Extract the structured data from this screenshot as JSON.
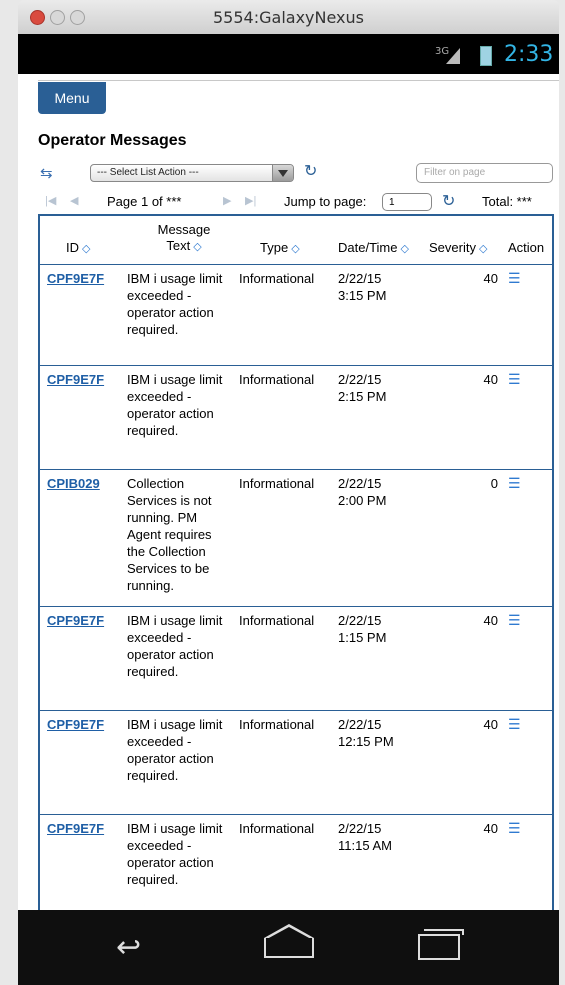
{
  "window": {
    "title": "5554:GalaxyNexus"
  },
  "status_bar": {
    "network": "3G",
    "time": "2:33"
  },
  "header": {
    "menu_label": "Menu",
    "page_title": "Operator Messages"
  },
  "toolbar": {
    "select_value": "--- Select List Action ---",
    "filter_placeholder": "Filter on page"
  },
  "pager": {
    "page_label": "Page 1 of ***",
    "jump_label": "Jump to page:",
    "jump_value": "1",
    "total_label": "Total: ***"
  },
  "table": {
    "columns": [
      "ID",
      "Message Text",
      "Type",
      "Date/Time",
      "Severity",
      "Action"
    ],
    "rows": [
      {
        "id": "CPF9E7F",
        "text": "IBM i usage limit exceeded - operator action required.",
        "type": "Informational",
        "date": "2/22/15",
        "time": "3:15 PM",
        "severity": "40"
      },
      {
        "id": "CPF9E7F",
        "text": "IBM i usage limit exceeded - operator action required.",
        "type": "Informational",
        "date": "2/22/15",
        "time": "2:15 PM",
        "severity": "40"
      },
      {
        "id": "CPIB029",
        "text": "Collection Services is not running. PM Agent requires the Collection Services to be running.",
        "type": "Informational",
        "date": "2/22/15",
        "time": "2:00 PM",
        "severity": "0"
      },
      {
        "id": "CPF9E7F",
        "text": "IBM i usage limit exceeded - operator action required.",
        "type": "Informational",
        "date": "2/22/15",
        "time": "1:15 PM",
        "severity": "40"
      },
      {
        "id": "CPF9E7F",
        "text": "IBM i usage limit exceeded - operator action required.",
        "type": "Informational",
        "date": "2/22/15",
        "time": "12:15 PM",
        "severity": "40"
      },
      {
        "id": "CPF9E7F",
        "text": "IBM i usage limit exceeded - operator action required.",
        "type": "Informational",
        "date": "2/22/15",
        "time": "11:15 AM",
        "severity": "40"
      }
    ]
  },
  "icons": {
    "list_action": "arrows-icon",
    "refresh": "refresh-icon",
    "row_action": "list-icon",
    "nav_back": "back-icon",
    "nav_home": "home-icon",
    "nav_recent": "recent-apps-icon"
  },
  "colors": {
    "accent": "#2a5f95",
    "link": "#1f5fa6",
    "status_time": "#33b5e5"
  }
}
